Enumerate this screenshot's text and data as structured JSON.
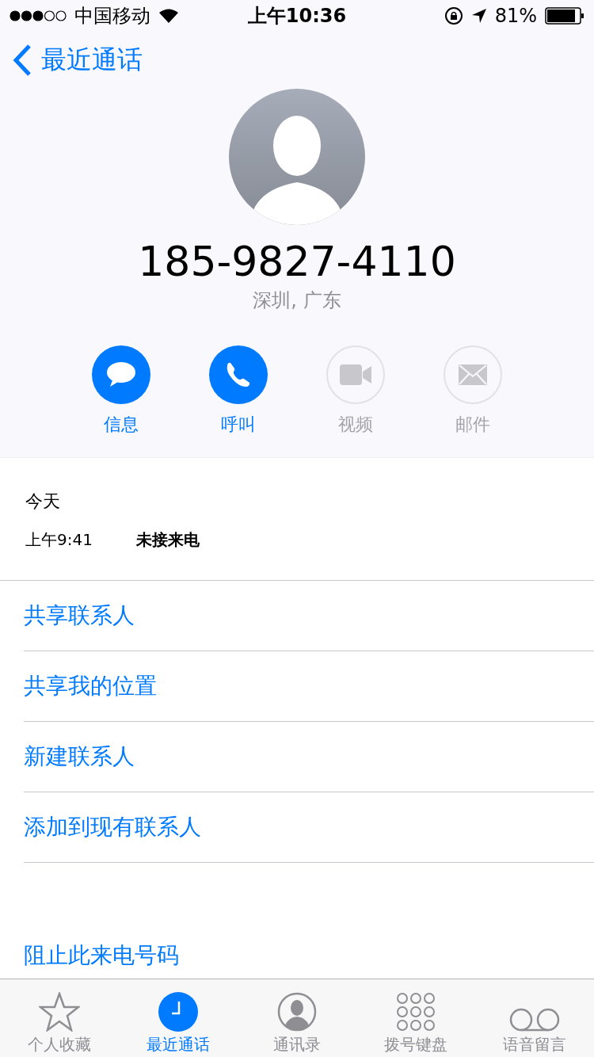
{
  "status_bar": {
    "carrier": "中国移动",
    "time": "上午10:36",
    "battery": "81%"
  },
  "nav": {
    "back": "最近通话"
  },
  "contact": {
    "number": "185-9827-4110",
    "location": "深圳, 广东"
  },
  "actions": [
    {
      "kind": "message",
      "label": "信息",
      "enabled": true
    },
    {
      "kind": "call",
      "label": "呼叫",
      "enabled": true
    },
    {
      "kind": "video",
      "label": "视频",
      "enabled": false
    },
    {
      "kind": "mail",
      "label": "邮件",
      "enabled": false
    }
  ],
  "history": {
    "day": "今天",
    "calls": [
      {
        "time": "上午9:41",
        "type": "未接来电"
      }
    ]
  },
  "options": [
    "共享联系人",
    "共享我的位置",
    "新建联系人",
    "添加到现有联系人"
  ],
  "block_option": "阻止此来电号码",
  "tabs": [
    {
      "kind": "favorites",
      "label": "个人收藏",
      "selected": false
    },
    {
      "kind": "recents",
      "label": "最近通话",
      "selected": true
    },
    {
      "kind": "contacts",
      "label": "通讯录",
      "selected": false
    },
    {
      "kind": "keypad",
      "label": "拨号键盘",
      "selected": false
    },
    {
      "kind": "voicemail",
      "label": "语音留言",
      "selected": false
    }
  ]
}
